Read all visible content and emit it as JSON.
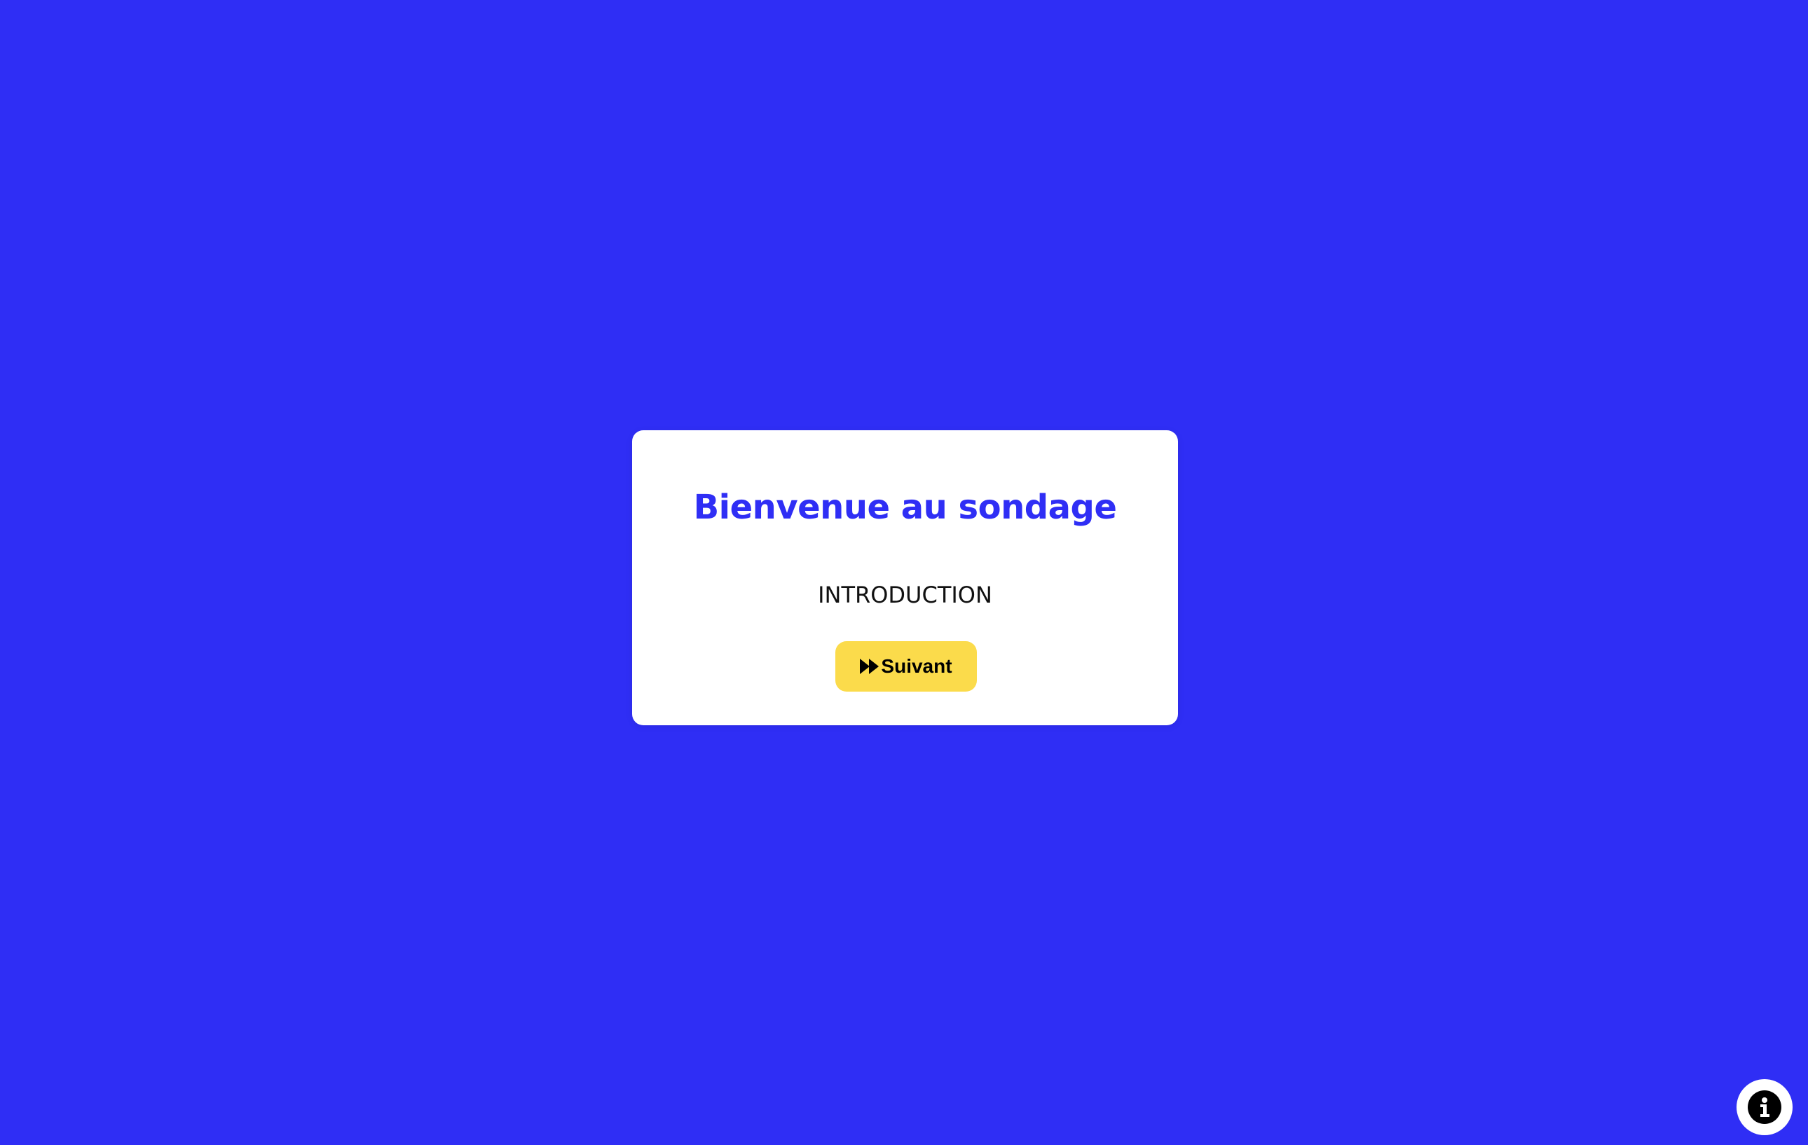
{
  "survey": {
    "title": "Bienvenue au sondage",
    "introduction": "INTRODUCTION",
    "next_label": "Suivant",
    "next_icon": "fast-forward-icon"
  },
  "info_button": {
    "icon": "info-icon"
  },
  "colors": {
    "background": "#2f2ef5",
    "title": "#2f2ef5",
    "button": "#fbdb4b"
  }
}
